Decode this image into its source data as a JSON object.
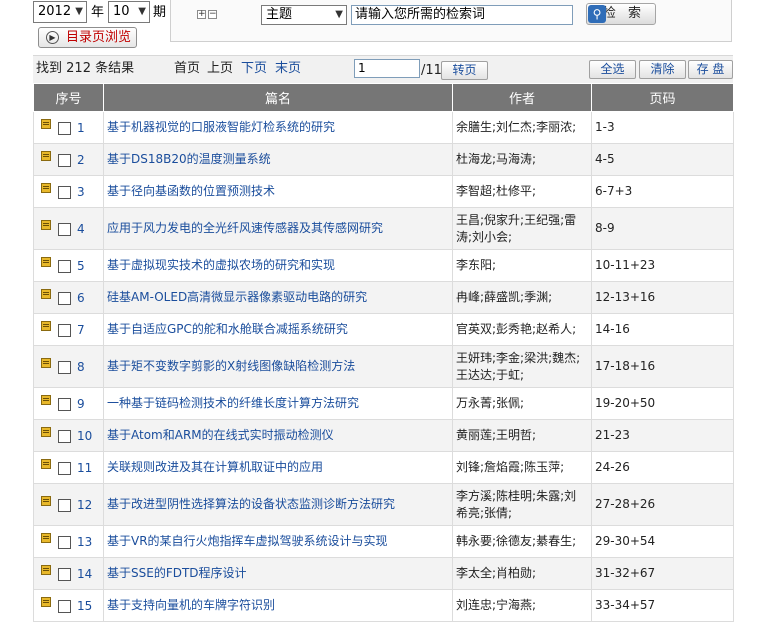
{
  "top": {
    "year": "2012",
    "year_label": "年",
    "period": "10",
    "period_label": "期",
    "plus": "+",
    "minus": "−",
    "field": "主题",
    "keyword_placeholder": "请输入您所需的检索词",
    "search_label": "检 索",
    "catalog_label": "目录页浏览",
    "icons": {
      "search": "magnifier-icon",
      "catalog": "catalog-icon",
      "dropdown": "chevron-down-icon"
    }
  },
  "toolbar": {
    "found_prefix": "找到",
    "found_count": "212",
    "found_suffix": "条结果",
    "first": "首页",
    "prev": "上页",
    "next": "下页",
    "last": "末页",
    "page_value": "1",
    "page_total": "/11",
    "goto": "转页",
    "select_all": "全选",
    "clear": "清除",
    "save": "存 盘"
  },
  "table": {
    "headers": [
      "序号",
      "篇名",
      "作者",
      "页码"
    ],
    "rows": [
      {
        "n": "1",
        "title": "基于机器视觉的口服液智能灯检系统的研究",
        "authors": "余膳生;刘仁杰;李丽浓;",
        "pages": "1-3"
      },
      {
        "n": "2",
        "title": "基于DS18B20的温度测量系统",
        "authors": "杜海龙;马海涛;",
        "pages": "4-5"
      },
      {
        "n": "3",
        "title": "基于径向基函数的位置预测技术",
        "authors": "李智超;杜修平;",
        "pages": "6-7+3"
      },
      {
        "n": "4",
        "title": "应用于风力发电的全光纤风速传感器及其传感网研究",
        "authors": "王昌;倪家升;王纪强;雷涛;刘小会;",
        "pages": "8-9"
      },
      {
        "n": "5",
        "title": "基于虚拟现实技术的虚拟农场的研究和实现",
        "authors": "李东阳;",
        "pages": "10-11+23"
      },
      {
        "n": "6",
        "title": "硅基AM-OLED高清微显示器像素驱动电路的研究",
        "authors": "冉峰;薛盛凯;季渊;",
        "pages": "12-13+16"
      },
      {
        "n": "7",
        "title": "基于自适应GPC的舵和水舱联合减摇系统研究",
        "authors": "官英双;彭秀艳;赵希人;",
        "pages": "14-16"
      },
      {
        "n": "8",
        "title": "基于矩不变数字剪影的X射线图像缺陷检测方法",
        "authors": "王妍玮;李金;梁洪;魏杰;王达达;于虹;",
        "pages": "17-18+16"
      },
      {
        "n": "9",
        "title": "一种基于链码检测技术的纤维长度计算方法研究",
        "authors": "万永菁;张佩;",
        "pages": "19-20+50"
      },
      {
        "n": "10",
        "title": "基于Atom和ARM的在线式实时振动检测仪",
        "authors": "黄丽莲;王明哲;",
        "pages": "21-23"
      },
      {
        "n": "11",
        "title": "关联规则改进及其在计算机取证中的应用",
        "authors": "刘锋;詹焰霞;陈玉萍;",
        "pages": "24-26"
      },
      {
        "n": "12",
        "title": "基于改进型阴性选择算法的设备状态监测诊断方法研究",
        "authors": "李方溪;陈桂明;朱露;刘希亮;张倩;",
        "pages": "27-28+26"
      },
      {
        "n": "13",
        "title": "基于VR的某自行火炮指挥车虚拟驾驶系统设计与实现",
        "authors": "韩永要;徐德友;綦春生;",
        "pages": "29-30+54"
      },
      {
        "n": "14",
        "title": "基于SSE的FDTD程序设计",
        "authors": "李太全;肖柏勋;",
        "pages": "31-32+67"
      },
      {
        "n": "15",
        "title": "基于支持向量机的车牌字符识别",
        "authors": "刘连忠;宁海燕;",
        "pages": "33-34+57"
      }
    ]
  }
}
